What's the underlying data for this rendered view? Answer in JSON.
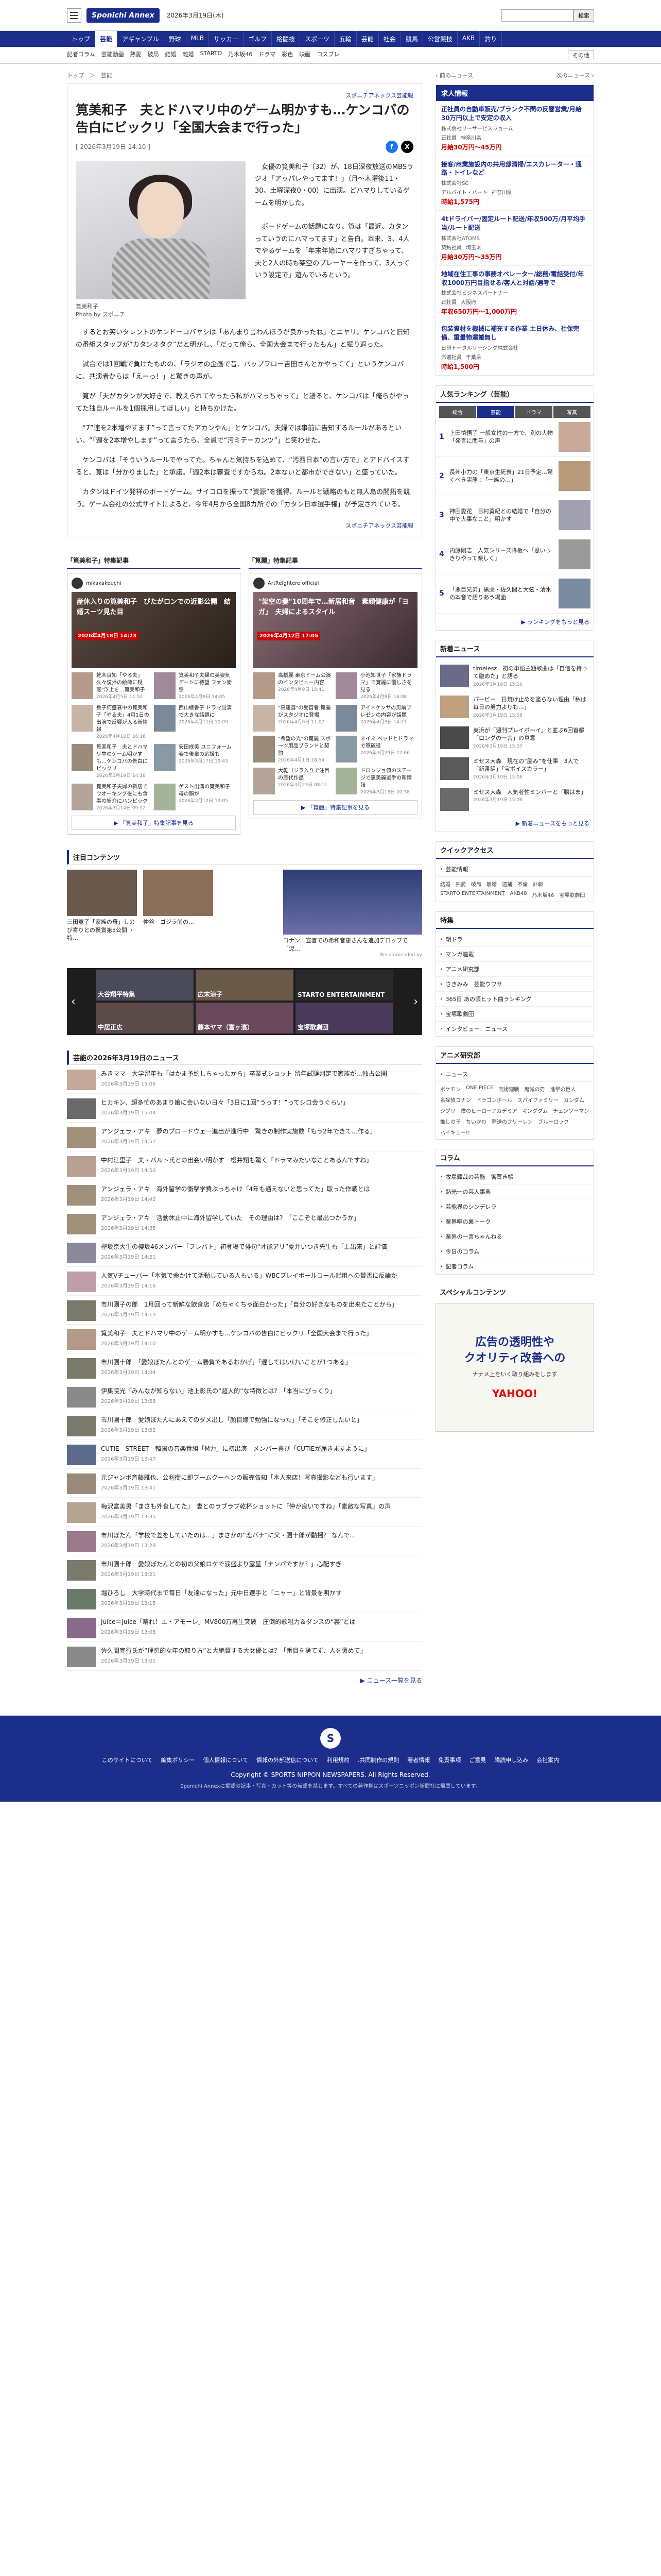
{
  "header": {
    "logo": "Sponichi Annex",
    "date": "2026年3月19日(木)",
    "search_button": "検索",
    "search_placeholder": ""
  },
  "gnav": [
    "トップ",
    "芸能",
    "アギャンブル",
    "野球",
    "MLB",
    "サッカー",
    "ゴルフ",
    "格闘技",
    "スポーツ",
    "五輪",
    "芸能",
    "社会",
    "競馬",
    "公営競技",
    "AKB",
    "釣り"
  ],
  "gnav_active": 1,
  "subnav": [
    "記者コラム",
    "芸能動画",
    "熱愛",
    "破局",
    "結婚",
    "離婚",
    "STARTO",
    "乃木坂46",
    "ドラマ",
    "彩色",
    "映画",
    "コスプレ"
  ],
  "subnav_more": "その他",
  "breadcrumb": "トップ　＞　芸能",
  "article": {
    "source": "スポニチアネックス芸能報",
    "title": "筧美和子　夫とドハマリ中のゲーム明かすも…ケンコバの告白にビックリ「全国大会まで行った」",
    "date": "[ 2026年3月19日 14:10 ]",
    "caption": "筧美和子\nPhoto by スポニチ",
    "lead": "　女優の筧美和子（32）が、18日深夜放送のMBSラジオ「アッパレやってます！」（月～木曜後11・30、土曜深夜0・00）に出演。どハマりしているゲームを明かした。\n\n　ボードゲームの話題になり、筧は「最近、カタンっていうのにハマってます」と告白。本来、3、4人でやるゲームを「年末年始にハマりすぎちゃって、夫と2人の時も架空のプレーヤーを作って、3人っていう設定で」遊んでいるという。",
    "paras": [
      "　するとお笑いタレントのケンドーコバヤシは「あんまり言わんほうが良かったね」とニヤリ。ケンコバと旧知の番組スタッフが“カタンオタク”だと明かし、「だって俺ら、全国大会まで行ったもん」と振り返った。",
      "　試合では1回戦で負けたものの、「ラジオの企画で昔、パップフロー吉田さんとかやってて」というケンコバに、共演者からは「えーっ！」と驚きの声が。",
      "　筧が「夫がカタンが大好きで、教えられてやったら私がハマっちゃって」と語ると、ケンコバは「俺らがやってた独自ルールを1個採用してほしい」と持ちかけた。",
      "　“7”連を2本増やすます”って言ってたアカンやん」とケンコバ。夫婦では事前に告知するルールがあるといい、“「週を2本増やします”って言うたら、全員で“汚ミテーカンツ”」と笑わせた。",
      "　ケンコバは「そういうルールでやってた。ちゃんと気持ちを込めて、“汚西日本”の言い方で」とアドバイスすると、筧は「分かりました」と承諾。「週2本は審査ですからね。2本ないと都市ができない」と盛っていた。",
      "　カタンはドイツ発祥のボードゲーム。サイコロを振って“資源”を獲得、ルールと戦略のもと無人島の開拓を競う。ゲーム会社の公式サイトによると、今年4月から全国8カ所での「カタン日本選手権」が予定されている。"
    ],
    "source2": "スポニチアネックス芸能報",
    "share": [
      "f",
      "X"
    ]
  },
  "features": [
    {
      "heading": "「筧美和子」特集記事",
      "account": "mikakakeuchi",
      "hero": "産休入りの筧美和子　ぴたがロンでの近影公開　結婚スーツ見た目",
      "hero_date": "2026年4月18日 14:23",
      "items": [
        {
          "t": "乾木良知「やる夫」久々復帰の絵師に疑惑\"浮上を…筧美和子",
          "ts": "2026年4月5日 11:52"
        },
        {
          "t": "筧美和子夫婦の美姿気デートに待望 ファン衝撃",
          "ts": "2026年4月8日 14:05"
        },
        {
          "t": "数子何盛衰中の筧美和子「やる夫」4月1日の出演で反響が入る新情報",
          "ts": "2026年4月10日 16:16"
        },
        {
          "t": "西山綾香子 ドラマ出演で大きな話題に",
          "ts": "2026年4月11日 10:09"
        },
        {
          "t": "筧美和子　夫とドハマリ中のゲーム明かすも…ケンコバの告白にビックリ",
          "ts": "2026年3月19日 14:10"
        },
        {
          "t": "安田成美 ユニフォーム姿で後輩の応援も",
          "ts": "2026年3月17日 19:43"
        },
        {
          "t": "筧美和子夫婦の新居で ウオーキング後にも食事の紹介にハンピック",
          "ts": "2026年3月14日 09:52"
        },
        {
          "t": "ゲスト出演の筧美和子 母の顔が",
          "ts": "2026年3月12日 13:05"
        }
      ],
      "more": "「筧美和子」特集記事を見る"
    },
    {
      "heading": "「筧麗」特集記事",
      "account": "ArtReIghtere official",
      "hero": "\"架空の妻\"10周年で…新居和音　素顔健康が「ヨガ」　夫婦によるスタイル",
      "hero_date": "2026年4月12日 17:05",
      "items": [
        {
          "t": "高橋麗 東京ドーム公演のインタビュー内容",
          "ts": "2026年4月9日 15:41"
        },
        {
          "t": "小池知世子「家族ドラマ」で筧麗に優しさを見る",
          "ts": "2026年4月8日 16:08"
        },
        {
          "t": "\"高遠賞\"の受賞者 筧麗がスタジオに登場",
          "ts": "2026年4月6日 11:07"
        },
        {
          "t": "アイネケンサの男前プレゼンの内容が話題",
          "ts": "2026年4月3日 14:23"
        },
        {
          "t": "\"希望の光\"の筧麗 スポーツ用品ブランドと契約",
          "ts": "2026年4月1日 18:54"
        },
        {
          "t": "ネイネ ベッドとドラマで筧麗役",
          "ts": "2026年3月29日 12:06"
        },
        {
          "t": "大乾ゴジラ入りで注目の歴代作品",
          "ts": "2026年3月23日 08:11"
        },
        {
          "t": "ドロンジョ値のステージで恵美麗選手の新情報",
          "ts": "2026年3月18日 20:38"
        }
      ],
      "more": "「筧麗」特集記事を見る"
    }
  ],
  "attention": {
    "heading": "注目コンテンツ",
    "items": [
      {
        "t": "三田寛子「家族の母」しのび寄りとの褒賞第5公開 ・特…"
      },
      {
        "t": "仲谷　ゴジラ前の…"
      }
    ],
    "sp": {
      "t": "コナン　宣言での希和音恵さんを追加デロップで「泥…",
      "by": "Recommended by"
    }
  },
  "carousel": [
    "大谷翔平特集",
    "広末涼子",
    "STARTO ENTERTAINMENT",
    "中居正広",
    "藤本ヤマ（富ヶ濱）",
    "宝塚歌劇団"
  ],
  "news": {
    "heading": "芸能の2026年3月19日のニュース",
    "items": [
      {
        "t": "みきママ　大学留年も「はかま予約しちゃったから」卒業式ショット 留年試験判定で家族が…独占公開",
        "ts": "2026年3月19日 15:06"
      },
      {
        "t": "ヒカキン、超多忙のあまり娘に会いない日々「3日に1回“うっす！”ってシロ会うぐらい」",
        "ts": "2026年3月19日 15:04"
      },
      {
        "t": "アンジェラ・アキ　夢のブロードウェー進出が進行中　驚きの制作実施数「もう2年できて…作る」",
        "ts": "2026年3月19日 14:57"
      },
      {
        "t": "中村江里子　夫・バルト氏との出会い明かす　櫻井翔も驚く「ドラマみたいなことあるんですね」",
        "ts": "2026年3月19日 14:50"
      },
      {
        "t": "アンジェラ・アキ　海外留学の衝撃学費ぶっちゃけ「4年も通えないと思ってた」取った作戦とは",
        "ts": "2026年3月19日 14:42"
      },
      {
        "t": "アンジェラ・アキ　活動休止中に海外留学していた　その理由は？「ここぞと最出つかうか」",
        "ts": "2026年3月19日 14:35"
      },
      {
        "t": "樫坂京大生の櫻坂46メンバー「プレバト」初登場で俳句“才能アリ”夏井いつき先生も「上出来」と評価",
        "ts": "2026年3月19日 14:21"
      },
      {
        "t": "人気Vチューバー「本気で命かけて活動している人もいる」WBCプレイボールコール起用への賛否に反論か",
        "ts": "2026年3月19日 14:16"
      },
      {
        "t": "市川團子の郎　1月回って新鮮な飲食店「めちゃくちゃ面白かった」「自分の好きなものを出来たことから」",
        "ts": "2026年3月19日 14:13"
      },
      {
        "t": "筧美和子　夫とドハマリ中のゲーム明かすも…ケンコバの告白にビックリ「全国大会まで行った」",
        "ts": "2026年3月19日 14:10"
      },
      {
        "t": "市川團十郎　「愛娘ぼたんとのゲーム勝負であるおかげ」「遅してはいけいことが1つある」",
        "ts": "2026年3月19日 14:04"
      },
      {
        "t": "伊集院光「みんなが知らない」池上彰氏の“超人的”な特徴とは？「本当にびっくり」",
        "ts": "2026年3月19日 13:58"
      },
      {
        "t": "市川團十郎　愛娘ぼたんにあえてのダメ出し「顔目線で勉強になった」「そこを修正したいと」",
        "ts": "2026年3月19日 13:52"
      },
      {
        "t": "CUTIE　STREET　韓国の音楽番組「M力」に初出演　メンバー喜び「CUTIEが届きますように」",
        "ts": "2026年3月19日 13:47"
      },
      {
        "t": "元ジャンポ斉藤雅也、公利衡に即ブームクーヘンの販売告知「本人来店！写真撮影なども行います」",
        "ts": "2026年3月19日 13:41"
      },
      {
        "t": "梅沢富美男「まさも外食してた」　妻とのラブラブ乾杯ショットに「仲が良いですね」「素敵な写真」の声",
        "ts": "2026年3月19日 13:35"
      },
      {
        "t": "市川ぼたん「学校で差をしていたのは…」まさかの“恋バナ”に父・團十郎が動揺？ なんで…",
        "ts": "2026年3月19日 13:29"
      },
      {
        "t": "市川團十郎　愛娘ぼたんとの初の父娘ロケで涙盛より露呈「ナンパですか？」心配すぎ",
        "ts": "2026年3月19日 13:21"
      },
      {
        "t": "堀ひろし　大学時代まで毎日「友達になった」元中日選手と「ニャー」と背景を明かす",
        "ts": "2026年3月19日 13:15"
      },
      {
        "t": "Juice＝Juice「晴れ！エ・アモーレ」MV800万再生突破　圧倒的歌唱力＆ダンスの“裏”とは",
        "ts": "2026年3月19日 13:08"
      },
      {
        "t": "佐久間宣行氏が“理想的な年の取り方”と大絶賛する大女優とは？「番目を捨てず、人を褒めて」",
        "ts": "2026年3月19日 13:02"
      }
    ],
    "more": "ニュース一覧を見る"
  },
  "side": {
    "nav_prev": "前のニュース",
    "nav_next": "次のニュース",
    "jobs_heading": "求人情報",
    "jobs": [
      {
        "t": "正社員の自動車販売/ブランク不問の反響営業/月給30万円以上で安定の収入",
        "c": "株式会社リーサービスジョーム",
        "tags": [
          "正社員",
          "神奈川県"
        ],
        "p": "月給30万円〜45万円"
      },
      {
        "t": "接客/商業施設内の共用部清掃/エスカレーター・通路・トイレなど",
        "c": "株式会社SC",
        "tags": [
          "アルバイト・パート",
          "神奈川県"
        ],
        "p": "時給1,575円"
      },
      {
        "t": "4tドライバー/固定ルート配送/年収500万/月平均手当/ルート配送",
        "c": "株式会社ATOMS",
        "tags": [
          "契約社員",
          "埼玉県"
        ],
        "p": "月給30万円〜35万円"
      },
      {
        "t": "地域在住工事の事務オペレーター/総務/電話受付/年収1000万円目指せる/客人と対話/選考で",
        "c": "株式会社ビジネスパートナー",
        "tags": [
          "正社員",
          "大阪府"
        ],
        "p": "年収650万円〜1,000万円"
      },
      {
        "t": "包装資材を機械に補充する作業 土日休み、社保完備、重量物運搬無し",
        "c": "日研トータルソーシング株式会社",
        "tags": [
          "派遣社員",
          "千葉県"
        ],
        "p": "時給1,500円"
      }
    ],
    "ranking_heading": "人気ランキング（芸能）",
    "ranking_tabs": [
      "総合",
      "芸能",
      "ドラマ",
      "写真"
    ],
    "ranking": [
      {
        "t": "上田慎悟子 一般女性の一方で、別の大物「発言に関与」の声"
      },
      {
        "t": "長州小力の「東京生死表」21日予定…驚くべき実態 ：「一族の…」"
      },
      {
        "t": "神田愛花　日村勇紀との結婚で「自分の中で大事なこと」明かす"
      },
      {
        "t": "内藤剛志　人気シリーズ降板へ「思いっきりやって楽しく」"
      },
      {
        "t": "「悪目兄弟」黒虎・佐久間と大弦・清水の本音で語りあう場面"
      }
    ],
    "ranking_more": "ランキングをもっと見る",
    "new_heading": "新着ニュース",
    "new_items": [
      {
        "t": "timelesz　初の単語主題歌曲は「自信を持って臨めた」と語る",
        "ts": "2026年3月19日 15:10"
      },
      {
        "t": "パーピー　日焼け止めを塗らない理由「私は毎日の努力よりも…」",
        "ts": "2026年3月19日 15:08"
      },
      {
        "t": "美浜が「週刊プレイボーイ」と並ぶ6回首都「ロングの一言」の真意",
        "ts": "2026年3月19日 15:07"
      },
      {
        "t": "ミセス大森　現在の“脳み”を仕事　3人で「新番組」「宝ボイスカラー」",
        "ts": "2026年3月19日 15:06"
      },
      {
        "t": "ミセス大森　人気者性ミンバーと「脳はま」",
        "ts": "2026年3月19日 15:06"
      }
    ],
    "new_more": "新着ニュースをもっと見る",
    "quick_heading": "クイックアクセス",
    "quick_links": [
      "芸能情報"
    ],
    "quick_tags": [
      "結婚",
      "熱愛",
      "破局",
      "離婚",
      "逮捕",
      "不倫",
      "訃報",
      "STARTO ENTERTAINMENT",
      "AKB48",
      "乃木坂46",
      "宝塚歌劇団"
    ],
    "special_heading": "特集",
    "special_links": [
      "朝ドラ",
      "マンガ連載",
      "アニメ研究部",
      "さきみみ　芸能ウワサ",
      "365日 あの頃ヒット曲ランキング",
      "宝塚歌劇団",
      "インタビュー　ニュース"
    ],
    "anime_heading": "アニメ研究部",
    "anime_links": [
      "ニュース"
    ],
    "anime_tags": [
      "ポケモン",
      "ONE PIECE",
      "呪術廻戦",
      "鬼滅の刃",
      "進撃の巨人",
      "名探偵コナン",
      "ドラゴンボール",
      "スパイファミリー",
      "ガンダム",
      "ジブリ",
      "僕のヒーローアカデミア",
      "キングダム",
      "チェンソーマン",
      "推しの子",
      "ちいかわ",
      "葬送のフリーレン",
      "ブルーロック",
      "ハイキュー!!"
    ],
    "column_heading": "コラム",
    "column_links": [
      "牧島輝哉の芸能　箸置き帳",
      "熱光一の芸人事典",
      "芸能界のシンデレラ",
      "業界噂の裏トーク",
      "業界の一言ちゃんねる",
      "今日のコラム",
      "記者コラム"
    ],
    "spc_heading": "スペシャルコンテンツ",
    "ad": {
      "l1": "広告の透明性や",
      "l2": "クオリティ改善への",
      "l3": "ナナメ上をいく取り組みをします",
      "brand": "YAHOO!"
    }
  },
  "footer": {
    "logo": "S",
    "links": [
      "このサイトについて",
      "編集ポリシー",
      "個人情報について",
      "情報の外部送信について",
      "利用規約",
      ".共同制作の規則",
      "著者情報",
      "免責事項",
      "ご意見",
      "購読申し込み",
      "会社案内"
    ],
    "copyright": "Copyright © SPORTS NIPPON NEWSPAPERS. All Rights Reserved.",
    "note": "Sponichi Annexに掲載の記事・写真・カット等の転載を禁じます。すべての著作権はスポーツニッポン新聞社に帰属しています。"
  },
  "colors": {
    "brand": "#1b2e8c",
    "accent": "#cc0000"
  }
}
